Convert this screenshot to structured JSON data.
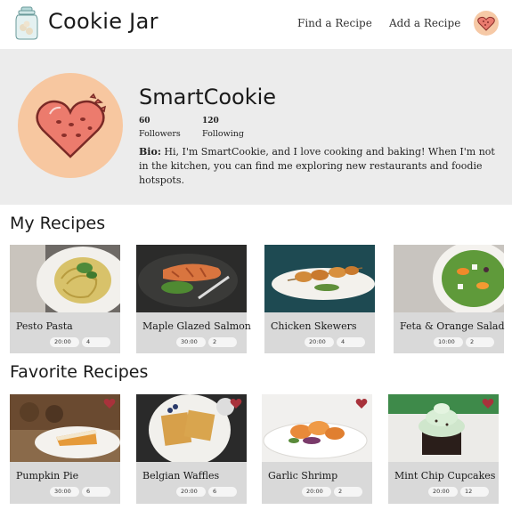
{
  "header": {
    "brand": "Cookie Jar",
    "nav": {
      "find_recipe": "Find a Recipe",
      "add_recipe": "Add a Recipe"
    }
  },
  "profile": {
    "username": "SmartCookie",
    "followers_count": "60",
    "followers_label": "Followers",
    "following_count": "120",
    "following_label": "Following",
    "bio_label": "Bio:",
    "bio_text": " Hi, I'm SmartCookie, and I love cooking and baking! When I'm not in the kitchen, you can find me exploring new restaurants and foodie hotspots."
  },
  "sections": {
    "my_recipes": "My Recipes",
    "favorite_recipes": "Favorite Recipes"
  },
  "my_recipes": [
    {
      "title": "Pesto Pasta",
      "time": "20:00",
      "servings": "4"
    },
    {
      "title": "Maple Glazed Salmon",
      "time": "30:00",
      "servings": "2"
    },
    {
      "title": "Chicken Skewers",
      "time": "20:00",
      "servings": "4"
    },
    {
      "title": "Feta & Orange Salad",
      "time": "10:00",
      "servings": "2"
    }
  ],
  "favorite_recipes": [
    {
      "title": "Pumpkin Pie",
      "time": "30:00",
      "servings": "6"
    },
    {
      "title": "Belgian Waffles",
      "time": "20:00",
      "servings": "6"
    },
    {
      "title": "Garlic Shrimp",
      "time": "20:00",
      "servings": "2"
    },
    {
      "title": "Mint Chip Cupcakes",
      "time": "20:00",
      "servings": "12"
    }
  ],
  "colors": {
    "heart_favorite": "#a8323b",
    "avatar_bg": "#f7c7a0",
    "card_bg": "#d9d9d9",
    "profile_bg": "#ececec"
  }
}
